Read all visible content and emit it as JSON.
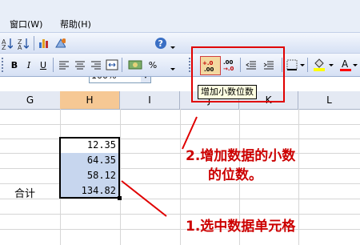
{
  "menu": {
    "window": "窗口(W)",
    "help": "帮助(H)"
  },
  "toolbar": {
    "zoom": "100%",
    "bold": "B",
    "italic": "I",
    "underline": "U",
    "percent": "%",
    "increase_decimal_caption": "+.0\n.00",
    "decrease_decimal_caption": ".00\n→.0"
  },
  "tooltip": "增加小数位数",
  "columns": [
    "G",
    "H",
    "I",
    "J",
    "K",
    "L"
  ],
  "selected_column": "H",
  "cells": [
    "12.35",
    "64.35",
    "58.12",
    "134.82"
  ],
  "label_total": "合计",
  "annotations": {
    "step1": "1.选中数据单元格",
    "step2_line1": "2.增加数据的小数",
    "step2_line2": "的位数。"
  },
  "colors": {
    "annotation": "#cc0000",
    "selection": "#c7d6ee",
    "selected_header": "#f6c894"
  }
}
